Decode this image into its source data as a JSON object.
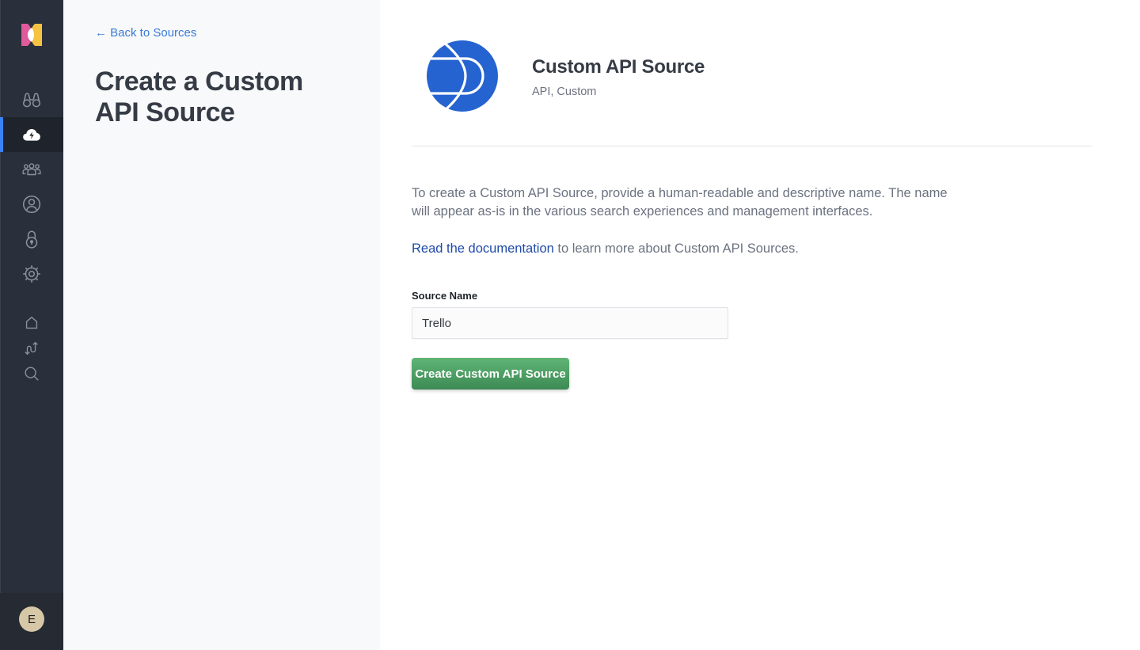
{
  "sidebar": {
    "logo": "app-logo",
    "items": [
      {
        "name": "explore",
        "icon": "binoculars-icon",
        "active": false
      },
      {
        "name": "sources",
        "icon": "cloud-bolt-icon",
        "active": true
      },
      {
        "name": "groups",
        "icon": "users-icon",
        "active": false
      },
      {
        "name": "account",
        "icon": "user-circle-icon",
        "active": false
      },
      {
        "name": "security",
        "icon": "lock-icon",
        "active": false
      },
      {
        "name": "settings",
        "icon": "gear-icon",
        "active": false
      },
      {
        "name": "home",
        "icon": "home-icon",
        "active": false
      },
      {
        "name": "workflow",
        "icon": "arrows-flow-icon",
        "active": false
      },
      {
        "name": "search",
        "icon": "search-icon",
        "active": false
      }
    ],
    "avatar_initial": "E"
  },
  "left_panel": {
    "back_link": "← Back to Sources",
    "title": "Create a Custom API Source"
  },
  "source": {
    "title": "Custom API Source",
    "tags": "API, Custom",
    "logo_color": "#2563d0"
  },
  "content": {
    "description": "To create a Custom API Source, provide a human-readable and descriptive name. The name will appear as-is in the various search experiences and management interfaces.",
    "docs_link": "Read the documentation",
    "docs_suffix": " to learn more about Custom API Sources."
  },
  "form": {
    "source_name_label": "Source Name",
    "source_name_value": "Trello",
    "submit_label": "Create Custom API Source"
  },
  "colors": {
    "accent": "#3b82f6",
    "primary_button": "#4a9d63",
    "link": "#1f4aa8",
    "sidebar": "#2a303b"
  }
}
